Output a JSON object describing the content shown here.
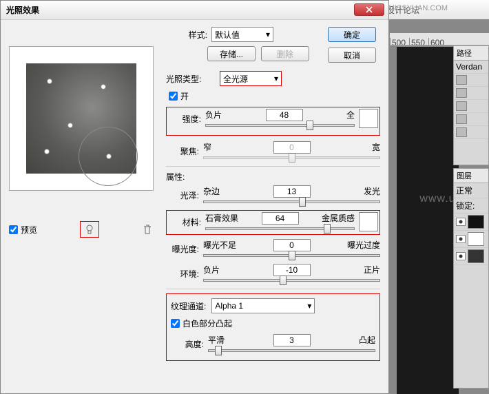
{
  "dialog": {
    "title": "光照效果",
    "ok": "确定",
    "cancel": "取消",
    "style_label": "样式:",
    "style_value": "默认值",
    "save": "存储...",
    "delete": "删除",
    "light_type_label": "光照类型:",
    "light_type_value": "全光源",
    "on_label": "开",
    "intensity_label": "强度:",
    "intensity_left": "负片",
    "intensity_right": "全",
    "intensity_value": "48",
    "focus_label": "聚焦:",
    "focus_left": "窄",
    "focus_right": "宽",
    "focus_value": "0",
    "props_label": "属性:",
    "gloss_label": "光泽:",
    "gloss_left": "杂边",
    "gloss_right": "发光",
    "gloss_value": "13",
    "material_label": "材料:",
    "material_left": "石膏效果",
    "material_right": "金属质感",
    "material_value": "64",
    "exposure_label": "曝光度:",
    "exposure_left": "曝光不足",
    "exposure_right": "曝光过度",
    "exposure_value": "0",
    "ambience_label": "环境:",
    "ambience_left": "负片",
    "ambience_right": "正片",
    "ambience_value": "-10",
    "texture_channel_label": "纹理通道:",
    "texture_channel_value": "Alpha 1",
    "white_high_label": "白色部分凸起",
    "height_label": "高度:",
    "height_left": "平滑",
    "height_right": "凸起",
    "height_value": "3",
    "preview_label": "预览"
  },
  "host": {
    "brand": "思缘设计论坛",
    "url": "WWW.MISSYUAN.COM",
    "watermark": "www.uicoc",
    "ruler": [
      "500",
      "550",
      "600"
    ],
    "char_tab": "路径",
    "font_value": "Verdan",
    "layers_tab": "图层",
    "blend_mode": "正常",
    "lock_label": "锁定:"
  }
}
